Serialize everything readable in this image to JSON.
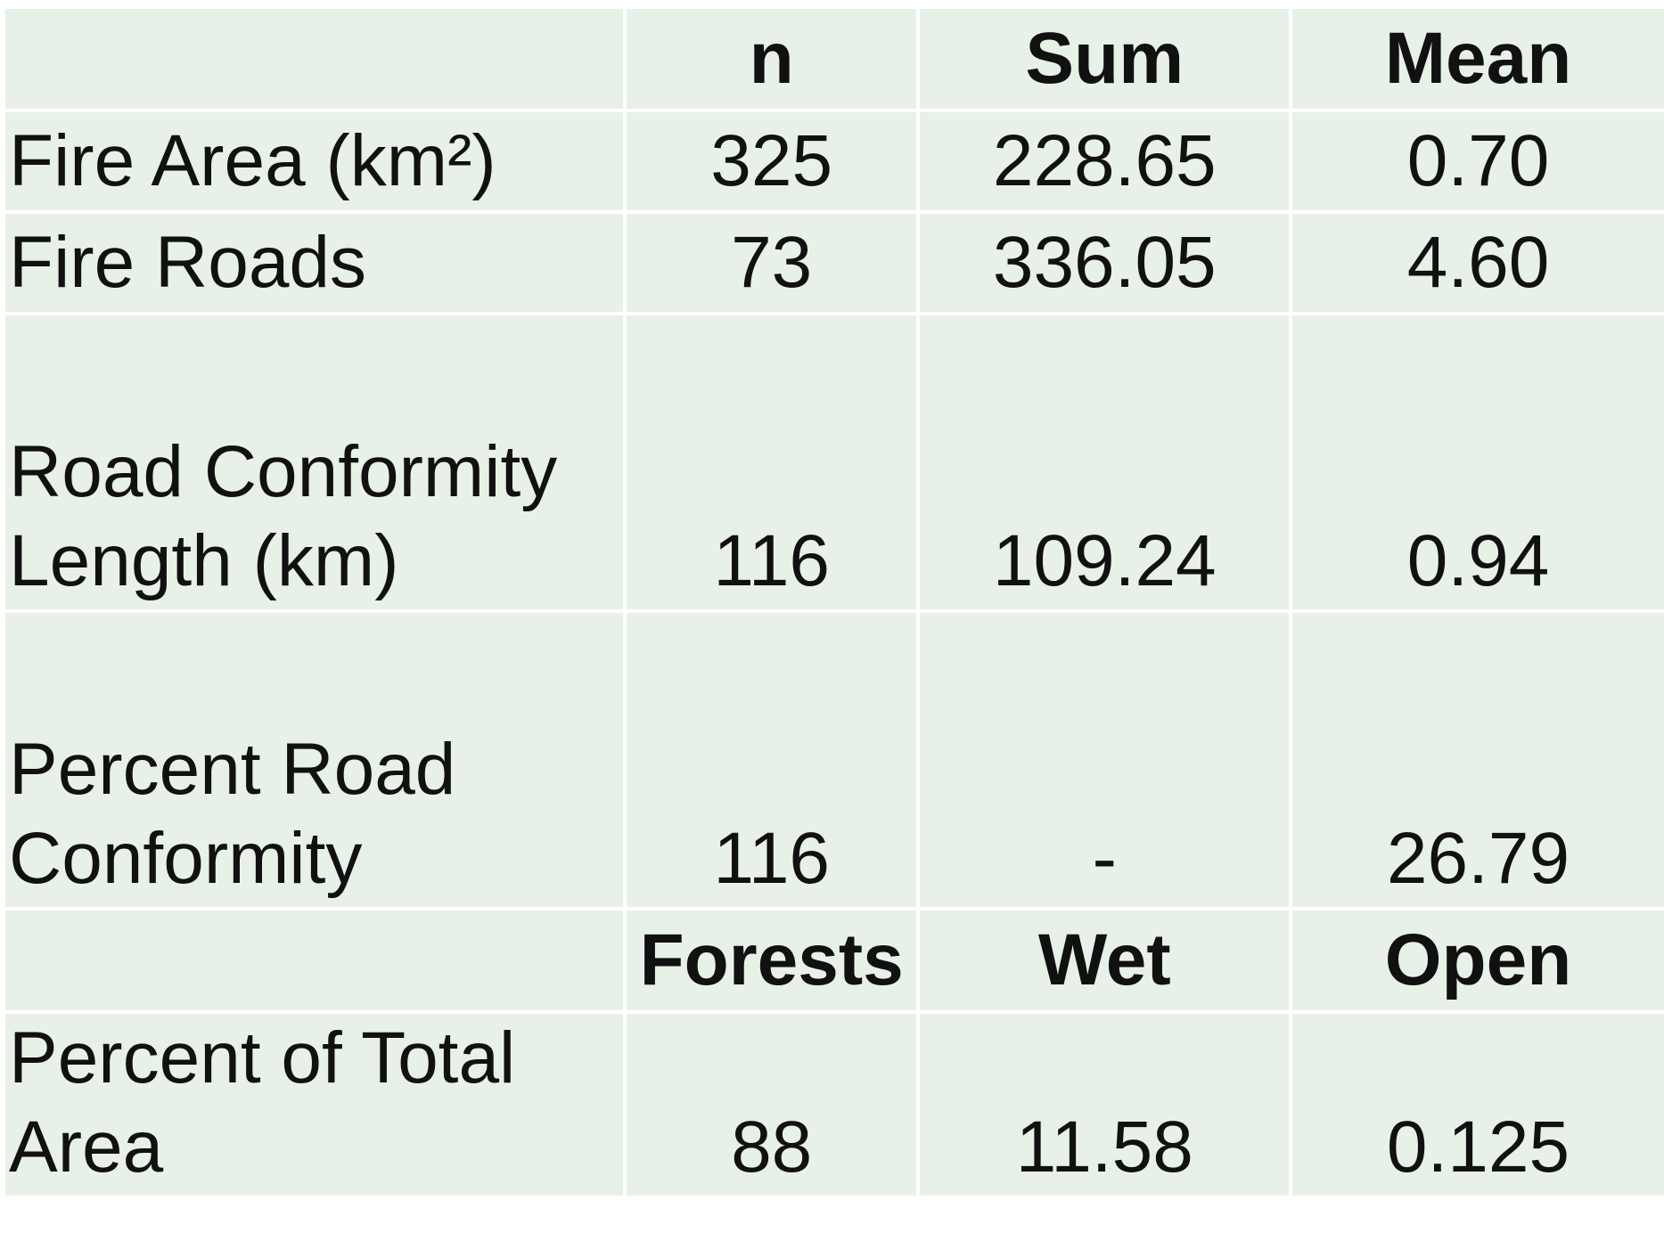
{
  "table": {
    "header": {
      "blank": "",
      "n": "n",
      "sum": "Sum",
      "mean": "Mean"
    },
    "rows": [
      {
        "label_lines": [
          "Fire Area (km²)"
        ],
        "n": "325",
        "sum": "228.65",
        "mean": "0.70"
      },
      {
        "label_lines": [
          "Fire Roads"
        ],
        "n": "73",
        "sum": "336.05",
        "mean": "4.60"
      },
      {
        "label_lines": [
          "Road Conformity",
          "Length (km)"
        ],
        "n": "116",
        "sum": "109.24",
        "mean": "0.94"
      },
      {
        "label_lines": [
          "Percent Road",
          "Conformity"
        ],
        "n": "116",
        "sum": "-",
        "mean": "26.79"
      }
    ],
    "subheader": {
      "blank": "",
      "forests": "Forests",
      "wet": "Wet",
      "open": "Open"
    },
    "landcover_row": {
      "label_lines": [
        "Percent of Total",
        "Area"
      ],
      "forests": "88",
      "wet": "11.58",
      "open": "0.125"
    }
  }
}
